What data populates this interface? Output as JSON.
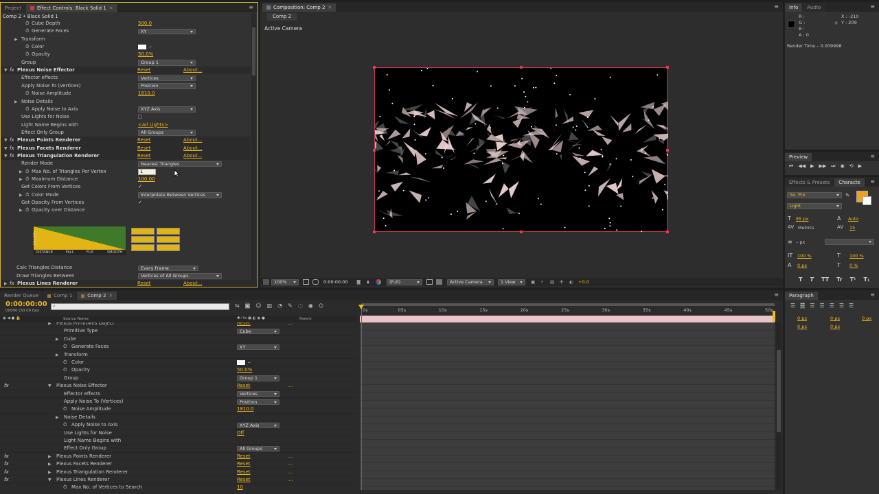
{
  "left_panel": {
    "tabs": [
      "Project",
      "Effect Controls: Black Solid 1"
    ],
    "breadcrumb": "Comp 2 • Black Solid 1",
    "rows": [
      {
        "label": "Cube Depth",
        "indent": 2,
        "sw": true,
        "value": "500.0",
        "kind": "val"
      },
      {
        "label": "Generate Faces",
        "indent": 2,
        "sw": true,
        "value": "XY",
        "kind": "dd"
      },
      {
        "label": "Transform",
        "indent": 1,
        "tw": true,
        "kind": "none"
      },
      {
        "label": "Color",
        "indent": 2,
        "sw": true,
        "kind": "color"
      },
      {
        "label": "Opacity",
        "indent": 2,
        "sw": true,
        "value": "50.0%",
        "kind": "val"
      },
      {
        "label": "Group",
        "indent": 1,
        "value": "Group 1",
        "kind": "dd"
      },
      {
        "label": "Plexus Noise Effector",
        "indent": 0,
        "fx": true,
        "tw": true,
        "bold": true,
        "kind": "reset"
      },
      {
        "label": "Effector effects",
        "indent": 1,
        "value": "Vertices",
        "kind": "dd"
      },
      {
        "label": "Apply Noise To (Vertices)",
        "indent": 1,
        "value": "Position",
        "kind": "dd"
      },
      {
        "label": "Noise Amplitude",
        "indent": 2,
        "sw": true,
        "value": "1810.0",
        "kind": "val"
      },
      {
        "label": "Noise Details",
        "indent": 1,
        "tw": true,
        "kind": "none"
      },
      {
        "label": "Apply Noise to Axis",
        "indent": 2,
        "sw": true,
        "value": "XYZ Axis",
        "kind": "dd"
      },
      {
        "label": "Use Lights for Noise",
        "indent": 1,
        "kind": "checkoff"
      },
      {
        "label": "Light Name Begins with",
        "indent": 1,
        "value": "<All Lights>",
        "kind": "val"
      },
      {
        "label": "Effect Only Group",
        "indent": 1,
        "value": "All Groups",
        "kind": "dd"
      },
      {
        "label": "Plexus Points Renderer",
        "indent": 0,
        "fx": true,
        "tw": true,
        "bold": true,
        "kind": "reset"
      },
      {
        "label": "Plexus Facets Renderer",
        "indent": 0,
        "fx": true,
        "tw": true,
        "bold": true,
        "kind": "reset"
      },
      {
        "label": "Plexus Triangulation Renderer",
        "indent": 0,
        "fx": true,
        "tw": true,
        "bold": true,
        "kind": "reset"
      },
      {
        "label": "Render Mode",
        "indent": 1,
        "value": "Nearest Triangles",
        "kind": "dd"
      },
      {
        "label": "Max No. of Triangles Per Vertex",
        "indent": 2,
        "sw": true,
        "tw": true,
        "value": "1",
        "kind": "edit"
      },
      {
        "label": "Maximum Distance",
        "indent": 2,
        "sw": true,
        "tw": true,
        "value": "100.00",
        "kind": "val"
      },
      {
        "label": "Get Colors From Vertices",
        "indent": 1,
        "kind": "check"
      },
      {
        "label": "Color Mode",
        "indent": 2,
        "sw": true,
        "tw": true,
        "value": "Interpolate Between Vertices",
        "kind": "dd"
      },
      {
        "label": "Get Opacity From Vertices",
        "indent": 1,
        "kind": "check"
      },
      {
        "label": "Opacity over Distance",
        "indent": 2,
        "sw": true,
        "tw": true,
        "kind": "none"
      }
    ],
    "reset_label": "Reset",
    "about_label": "About...",
    "check_glyph": "✓",
    "graph": {
      "axis_y": "OPACITY",
      "axis_x": [
        "DISTANCE",
        "FALL",
        "FLIP",
        "SMOOTH"
      ]
    },
    "bottom_rows": [
      {
        "label": "Calc Triangles Distance",
        "value": "Every Frame",
        "kind": "dd"
      },
      {
        "label": "Draw Triangles Between",
        "value": "Vertices of All Groups",
        "kind": "dd"
      },
      {
        "label": "Plexus Lines Renderer",
        "kind": "reset",
        "bold": true
      }
    ],
    "accent": "#f0b81e"
  },
  "comp_panel": {
    "tab": "Composition: Comp 2",
    "subtab": "Comp 2",
    "camera_label": "Active Camera",
    "toolbar": {
      "zoom": "100%",
      "timecode": "0:00:00:00",
      "resolution": "(Full)",
      "camera": "Active Camera",
      "view": "1 View",
      "exposure": "+0.0"
    }
  },
  "info_panel": {
    "tabs": [
      "Info",
      "Audio"
    ],
    "r": "R :",
    "g": "G :",
    "b": "B :",
    "a": "A : 0",
    "x": "X : -210",
    "y": "Y : 209",
    "render_time": "Render Time – 0.009998"
  },
  "preview_panel": {
    "tab": "Preview"
  },
  "char_panel": {
    "tabs": [
      "Effects & Presets",
      "Characte"
    ],
    "font": "So. Pro",
    "style": "Light",
    "size": "85 px",
    "leading": "Auto",
    "kerning": "Metrics",
    "tracking": "15",
    "stroke": "– px",
    "vscale": "100 %",
    "hscale": "100 %",
    "baseline": "0 px",
    "tsume": "0 %",
    "styles": [
      "T",
      "T",
      "TT",
      "Tr",
      "T¹",
      "T₁"
    ]
  },
  "paragraph_panel": {
    "tab": "Paragraph",
    "vals": [
      "0 px",
      "0 px",
      "0 px",
      "0 px",
      "0 px"
    ]
  },
  "timeline": {
    "tabs": [
      "Render Queue",
      "Comp 1",
      "Comp 2"
    ],
    "timecode": "0:00:00:00",
    "fps": "00000 (30.00 fps)",
    "col_source": "Source Name",
    "col_parent": "Parent",
    "ruler": [
      "0s",
      "05s",
      "10s",
      "15s",
      "20s",
      "25s",
      "30s",
      "35s",
      "40s",
      "45s",
      "50s"
    ],
    "rows": [
      {
        "label": "Plexus Primitives Object",
        "indent": 1,
        "tw": true,
        "value": "Reset",
        "kind": "reset"
      },
      {
        "label": "Primitive Type",
        "indent": 2,
        "value": "Cube",
        "kind": "dd"
      },
      {
        "label": "Cube",
        "indent": 2,
        "tw": true,
        "kind": "none"
      },
      {
        "label": "Generate Faces",
        "indent": 3,
        "sw": true,
        "value": "XY",
        "kind": "dd"
      },
      {
        "label": "Transform",
        "indent": 2,
        "tw": true,
        "kind": "none"
      },
      {
        "label": "Color",
        "indent": 3,
        "sw": true,
        "kind": "color"
      },
      {
        "label": "Opacity",
        "indent": 3,
        "sw": true,
        "value": "50.0%",
        "kind": "val"
      },
      {
        "label": "Group",
        "indent": 2,
        "value": "Group 1",
        "kind": "dd"
      },
      {
        "label": "Plexus Noise Effector",
        "indent": 1,
        "fx": true,
        "tw": true,
        "value": "Reset",
        "kind": "reset"
      },
      {
        "label": "Effector effects",
        "indent": 2,
        "value": "Vertices",
        "kind": "dd"
      },
      {
        "label": "Apply Noise To (Vertices)",
        "indent": 2,
        "value": "Position",
        "kind": "dd"
      },
      {
        "label": "Noise Amplitude",
        "indent": 3,
        "sw": true,
        "value": "1810.0",
        "kind": "val"
      },
      {
        "label": "Noise Details",
        "indent": 2,
        "tw": true,
        "kind": "none"
      },
      {
        "label": "Apply Noise to Axis",
        "indent": 3,
        "sw": true,
        "value": "XYZ Axis",
        "kind": "dd"
      },
      {
        "label": "Use Lights for Noise",
        "indent": 2,
        "value": "Off",
        "kind": "val"
      },
      {
        "label": "Light Name Begins with",
        "indent": 2,
        "kind": "none"
      },
      {
        "label": "Effect Only Group",
        "indent": 2,
        "value": "All Groups",
        "kind": "dd"
      },
      {
        "label": "Plexus Points Renderer",
        "indent": 1,
        "fx": true,
        "tw": true,
        "value": "Reset",
        "kind": "reset"
      },
      {
        "label": "Plexus Facets Renderer",
        "indent": 1,
        "fx": true,
        "tw": true,
        "value": "Reset",
        "kind": "reset"
      },
      {
        "label": "Plexus Triangulation Renderer",
        "indent": 1,
        "fx": true,
        "tw": true,
        "value": "Reset",
        "kind": "reset"
      },
      {
        "label": "Plexus Lines Renderer",
        "indent": 1,
        "fx": true,
        "tw": true,
        "value": "Reset",
        "kind": "reset"
      },
      {
        "label": "Max No. of Vertices to Search",
        "indent": 3,
        "sw": true,
        "value": "10",
        "kind": "val"
      }
    ]
  }
}
